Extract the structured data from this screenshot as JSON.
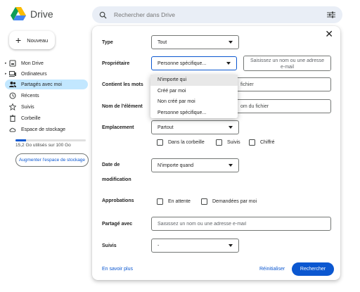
{
  "app": {
    "title": "Drive"
  },
  "search": {
    "placeholder": "Rechercher dans Drive"
  },
  "sidebar": {
    "new_label": "Nouveau",
    "items": [
      {
        "label": "Mon Drive",
        "icon": "drive-icon"
      },
      {
        "label": "Ordinateurs",
        "icon": "computer-icon"
      },
      {
        "label": "Partagés avec moi",
        "icon": "people-icon"
      },
      {
        "label": "Récents",
        "icon": "clock-icon"
      },
      {
        "label": "Suivis",
        "icon": "star-icon"
      },
      {
        "label": "Corbeille",
        "icon": "trash-icon"
      },
      {
        "label": "Espace de stockage",
        "icon": "cloud-icon"
      }
    ],
    "storage_text": "15,2 Go utilisés sur 100 Go",
    "storage_fraction": 0.152,
    "upgrade_label": "Augmenter l'espace de stockage"
  },
  "dialog": {
    "type": {
      "label": "Type",
      "value": "Tout"
    },
    "owner": {
      "label": "Propriétaire",
      "value": "Personne spécifique...",
      "input_placeholder": "Saisissez un nom ou une adresse e-mail",
      "menu": [
        "N'importe qui",
        "Créé par moi",
        "Non créé par moi",
        "Personne spécifique..."
      ]
    },
    "words": {
      "label": "Contient les mots",
      "placeholder_tail": "fichier"
    },
    "item_name": {
      "label": "Nom de l'élément",
      "placeholder_tail": "om du fichier"
    },
    "location": {
      "label": "Emplacement",
      "value": "Partout",
      "options": [
        "Dans la corbeille",
        "Suivis",
        "Chiffré"
      ]
    },
    "modified": {
      "label_line1": "Date de",
      "label_line2": "modification",
      "value": "N'importe quand"
    },
    "approvals": {
      "label": "Approbations",
      "options": [
        "En attente",
        "Demandées par moi"
      ]
    },
    "shared_with": {
      "label": "Partagé avec",
      "placeholder": "Saisissez un nom ou une adresse e-mail"
    },
    "followed": {
      "label": "Suivis",
      "value": "-"
    },
    "learn_more": "En savoir plus",
    "reset": "Réinitialiser",
    "submit": "Rechercher"
  },
  "colors": {
    "accent": "#0b57d0",
    "active_nav": "#c2e7ff",
    "search_bg": "#e9eef6"
  }
}
